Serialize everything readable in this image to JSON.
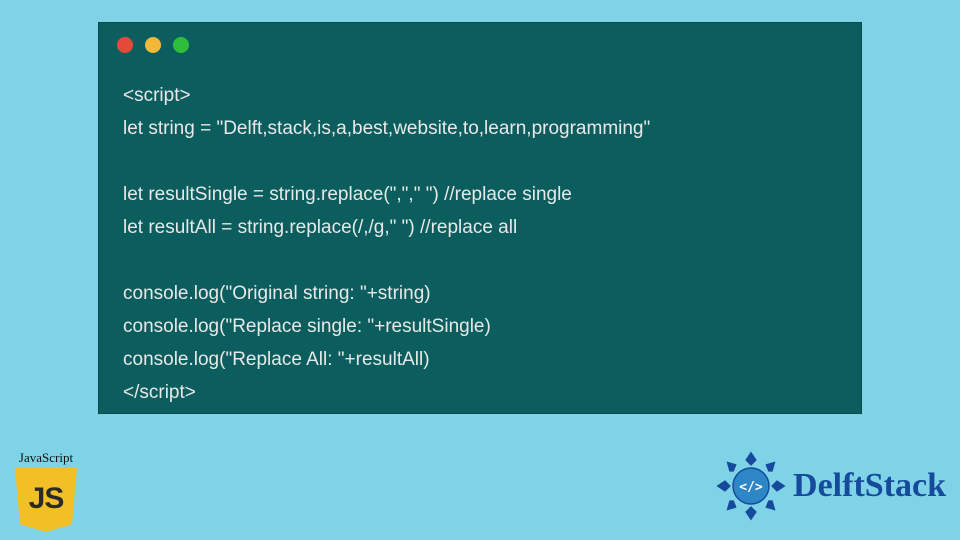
{
  "code": {
    "l1": "<script>",
    "l2": "let string = \"Delft,stack,is,a,best,website,to,learn,programming\"",
    "l3": "",
    "l4": "let resultSingle = string.replace(\",\",\" \") //replace single",
    "l5": "let resultAll = string.replace(/,/g,\" \") //replace all",
    "l6": "",
    "l7": "console.log(\"Original string: \"+string)",
    "l8": "console.log(\"Replace single: \"+resultSingle)",
    "l9": "console.log(\"Replace All: \"+resultAll)",
    "l10": "</script>"
  },
  "jsBadge": {
    "label": "JavaScript",
    "shieldText": "JS"
  },
  "brand": {
    "name": "DelftStack"
  }
}
